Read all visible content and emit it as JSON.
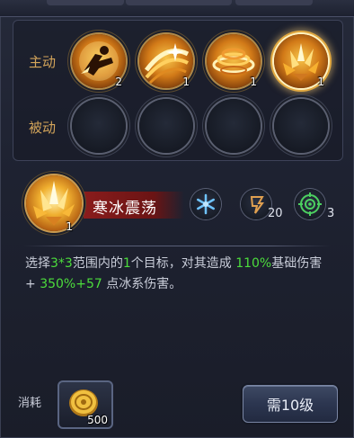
{
  "skills": {
    "active_label": "主动",
    "passive_label": "被动",
    "active": [
      {
        "icon": "dash-kick-icon",
        "count": "2"
      },
      {
        "icon": "golden-slash-icon",
        "count": "1"
      },
      {
        "icon": "whirlwind-icon",
        "count": "1"
      },
      {
        "icon": "ice-shatter-icon",
        "count": "1",
        "selected": true
      }
    ],
    "passive_slots": 4
  },
  "detail": {
    "icon": "ice-shatter-icon",
    "count": "1",
    "name": "寒冰震荡",
    "element_icon": "snowflake-icon",
    "cost_icon": "mana-rune-icon",
    "cost_value": "20",
    "cooldown_icon": "target-icon",
    "cooldown_value": "3",
    "description": {
      "p1": "选择",
      "range": "3*3",
      "p2": "范围内的",
      "targets": "1",
      "p3": "个目标，对其造成 ",
      "pct": "110%",
      "p4": "基础伤害 + ",
      "bonus": "350%+57",
      "p5": " 点冰系伤害。"
    }
  },
  "footer": {
    "cost_label": "消耗",
    "cost_item_icon": "gold-coin-icon",
    "cost_item_count": "500",
    "level_button": "需10级"
  },
  "colors": {
    "highlight_green": "#4cdc3c",
    "label_gold": "#d4a55a",
    "banner_red": "#8a1c1c"
  }
}
